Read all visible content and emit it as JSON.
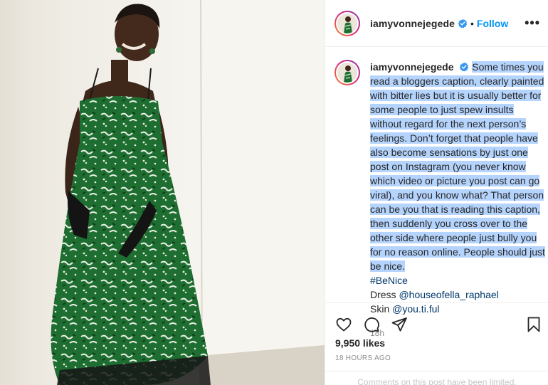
{
  "post": {
    "username": "iamyvonnejegede",
    "verified": true,
    "header_dot": "•",
    "follow_label": "Follow",
    "more_label": "•••",
    "caption_lines": [
      "Some times you",
      "read a bloggers caption, clearly painted",
      "with bitter lies but it is usually better for",
      "some people to just spew insults",
      "without regard for the next person’s",
      "feelings. Don’t forget that people have",
      "also become sensations by just one",
      "post on Instagram (you never know",
      "which video or picture you post can go",
      "viral), and you know what? That person",
      "can be you that is reading this caption,",
      "then suddenly you cross over to the",
      "other side where people just bully you",
      "for no reason online. People should just",
      "be nice."
    ],
    "hashtag": "#BeNice",
    "dress_label": "Dress",
    "dress_mention": "@houseofella_raphael",
    "skin_label": "Skin",
    "skin_mention": "@you.ti.ful",
    "caption_time": "18h",
    "likes": "9,950 likes",
    "posted_ago": "18 HOURS AGO",
    "comments_note": "Comments on this post have been limited."
  },
  "icons": {
    "like": "heart-icon",
    "comment": "comment-icon",
    "share": "paper-plane-icon",
    "save": "bookmark-icon",
    "verified": "verified-badge-icon"
  },
  "colors": {
    "link_blue": "#0095f6",
    "highlight": "#b5d4fd",
    "hashtag": "#00376b",
    "dress_green": "#1e6b2e"
  }
}
